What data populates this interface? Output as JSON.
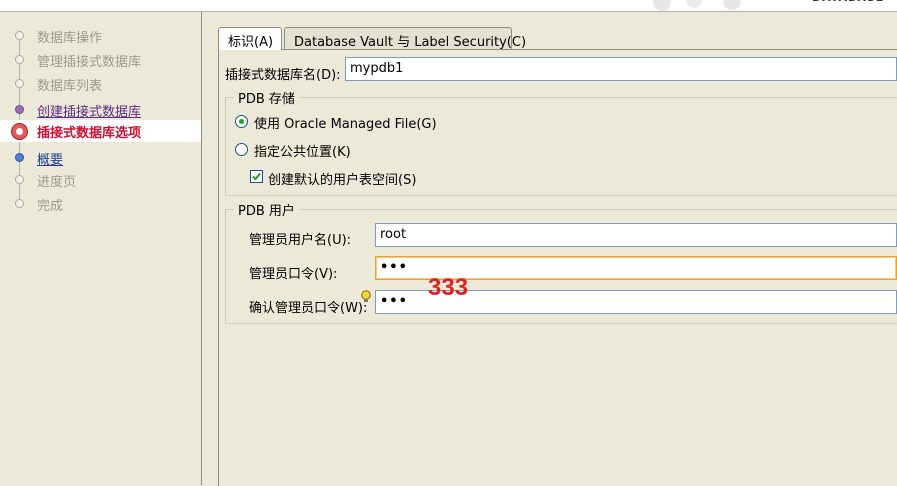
{
  "nav": {
    "steps": [
      {
        "label": "数据库操作",
        "state": "done"
      },
      {
        "label": "管理插接式数据库",
        "state": "done"
      },
      {
        "label": "数据库列表",
        "state": "done"
      },
      {
        "label": "创建插接式数据库",
        "state": "link"
      },
      {
        "label": "插接式数据库选项",
        "state": "current"
      },
      {
        "label": "概要",
        "state": "next"
      },
      {
        "label": "进度页",
        "state": "todo"
      },
      {
        "label": "完成",
        "state": "todo"
      }
    ]
  },
  "tabs": [
    {
      "label": "标识(A)",
      "active": true
    },
    {
      "label": "Database Vault 与 Label Security(C)",
      "active": false
    }
  ],
  "form": {
    "pdb_name_label": "插接式数据库名(D):",
    "pdb_name_value": "mypdb1",
    "storage_legend": "PDB 存储",
    "omf_label": "使用 Oracle Managed File(G)",
    "common_loc_label": "指定公共位置(K)",
    "default_ts_label": "创建默认的用户表空间(S)",
    "user_legend": "PDB 用户",
    "admin_user_label": "管理员用户名(U):",
    "admin_user_value": "root",
    "admin_pwd_label": "管理员口令(V):",
    "admin_pwd_value": "•••",
    "confirm_pwd_label": "确认管理员口令(W):",
    "confirm_pwd_value": "•••"
  },
  "annotation": "333",
  "colors": {
    "current_step": "#cc1133",
    "annotation": "#e02020",
    "focus_border": "#f0a030"
  }
}
